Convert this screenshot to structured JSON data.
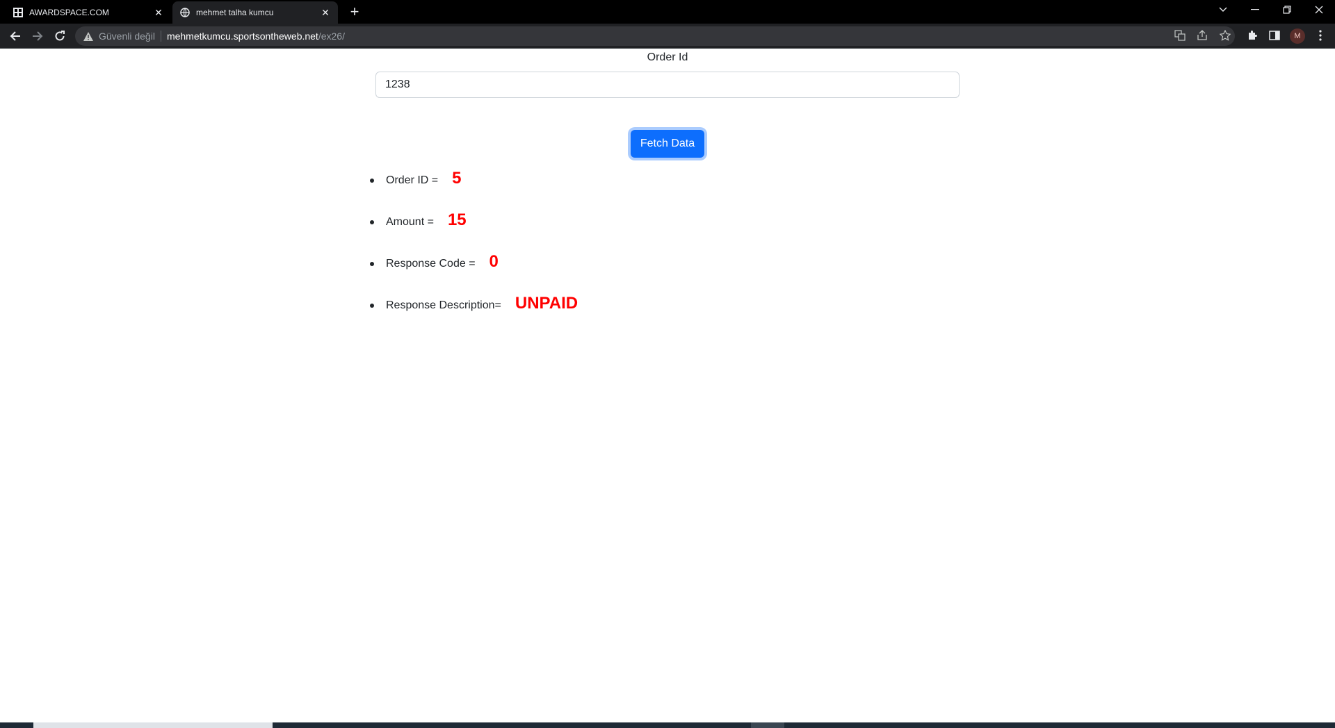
{
  "browser": {
    "tabs": [
      {
        "title": "AWARDSPACE.COM",
        "active": false
      },
      {
        "title": "mehmet talha kumcu",
        "active": true
      }
    ],
    "address": {
      "security_label": "Güvenli değil",
      "host": "mehmetkumcu.sportsontheweb.net",
      "path": "/ex26/"
    },
    "profile_initial": "M"
  },
  "form": {
    "label": "Order Id",
    "value": "1238",
    "button_label": "Fetch Data"
  },
  "results": [
    {
      "label": "Order ID =",
      "value": "5"
    },
    {
      "label": "Amount =",
      "value": "15"
    },
    {
      "label": "Response Code =",
      "value": "0"
    },
    {
      "label": "Response Description=",
      "value": "UNPAID"
    }
  ],
  "colors": {
    "accent": "#0d6efd",
    "value_red": "#ff0000"
  }
}
